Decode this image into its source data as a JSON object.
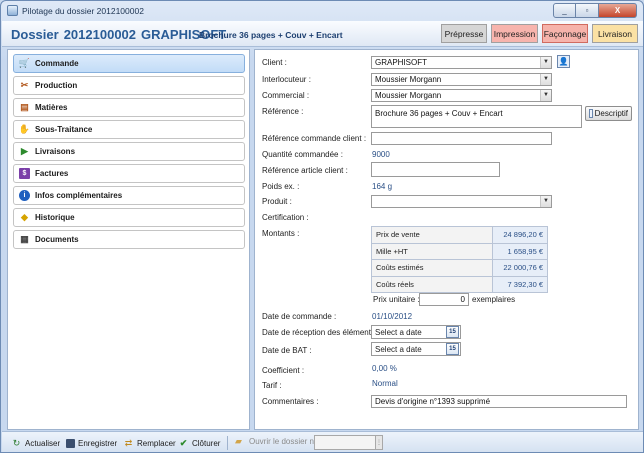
{
  "window": {
    "title": "Pilotage du dossier 2012100002",
    "minimize": "_",
    "maximize": "▫",
    "close": "X"
  },
  "header": {
    "label": "Dossier",
    "number": "2012100002",
    "client": "GRAPHISOFT",
    "description": "Brochure 36 pages + Couv + Encart",
    "stages": {
      "prepresse": "Prépresse",
      "impression": "Impression",
      "faconnage": "Façonnage",
      "livraison": "Livraison"
    }
  },
  "sidebar": {
    "items": [
      {
        "label": "Commande",
        "icon": "cart-icon"
      },
      {
        "label": "Production",
        "icon": "tools-icon"
      },
      {
        "label": "Matières",
        "icon": "paper-icon"
      },
      {
        "label": "Sous-Traitance",
        "icon": "handshake-icon"
      },
      {
        "label": "Livraisons",
        "icon": "truck-icon"
      },
      {
        "label": "Factures",
        "icon": "invoice-icon"
      },
      {
        "label": "Infos complémentaires",
        "icon": "info-icon"
      },
      {
        "label": "Historique",
        "icon": "history-icon"
      },
      {
        "label": "Documents",
        "icon": "documents-icon"
      }
    ]
  },
  "form": {
    "client": {
      "label": "Client :",
      "value": "GRAPHISOFT"
    },
    "interlocuteur": {
      "label": "Interlocuteur :",
      "value": "Moussier Morgann"
    },
    "commercial": {
      "label": "Commercial :",
      "value": "Moussier Morgann"
    },
    "reference": {
      "label": "Référence :",
      "value": "Brochure 36 pages + Couv + Encart",
      "button": "Descriptif"
    },
    "ref_commande_client": {
      "label": "Référence commande client :",
      "value": ""
    },
    "quantite": {
      "label": "Quantité commandée :",
      "value": "9000"
    },
    "ref_article_client": {
      "label": "Référence article client :",
      "value": ""
    },
    "poids": {
      "label": "Poids ex. :",
      "value": "164 g"
    },
    "produit": {
      "label": "Produit :",
      "value": ""
    },
    "certification": {
      "label": "Certification :"
    },
    "montants": {
      "label": "Montants :",
      "rows": [
        {
          "key": "Prix de vente",
          "value": "24 896,20 €"
        },
        {
          "key": "Mille +HT",
          "value": "1 658,95 €"
        },
        {
          "key": "Coûts estimés",
          "value": "22 000,76 €"
        },
        {
          "key": "Coûts réels",
          "value": "7 392,30 €"
        }
      ]
    },
    "prix_unitaire": {
      "label": "Prix unitaire :",
      "value": "0",
      "unit": "exemplaires"
    },
    "date_commande": {
      "label": "Date de commande :",
      "value": "01/10/2012"
    },
    "date_reception": {
      "label": "Date de réception des éléments :",
      "placeholder": "Select a date",
      "cal": "15"
    },
    "date_bat": {
      "label": "Date de BAT :",
      "placeholder": "Select a date",
      "cal": "15"
    },
    "coefficient": {
      "label": "Coefficient :",
      "value": "0,00 %"
    },
    "tarif": {
      "label": "Tarif :",
      "value": "Normal"
    },
    "commentaires": {
      "label": "Commentaires :",
      "value": "Devis d'origine n°1393 supprimé"
    }
  },
  "toolbar": {
    "actualiser": "Actualiser",
    "enregistrer": "Enregistrer",
    "remplacer": "Remplacer",
    "cloturer": "Clôturer",
    "ouvrir": "Ouvrir le dossier n° :",
    "grip": "⋮"
  }
}
